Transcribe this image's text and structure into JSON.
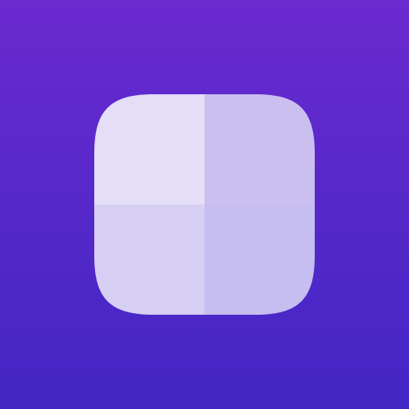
{
  "icon": {
    "name": "grid-squircle-icon",
    "colors": {
      "background_top": "#6a2ad0",
      "background_bottom": "#4226c4",
      "tile_top_left": "#e4def6",
      "tile_top_right": "#cbbff0",
      "tile_bottom_left": "#d6cff3",
      "tile_bottom_right": "#c6bdf0"
    }
  }
}
